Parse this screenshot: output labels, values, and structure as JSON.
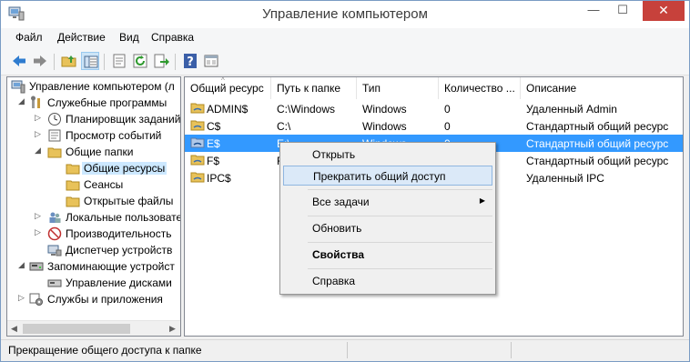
{
  "window": {
    "title": "Управление компьютером",
    "minimize": "—",
    "maximize": "☐",
    "close": "✕"
  },
  "menu": [
    "Файл",
    "Действие",
    "Вид",
    "Справка"
  ],
  "toolbar": {
    "icons": [
      "back-icon",
      "forward-icon",
      "up-folder-icon",
      "show-tree-icon",
      "properties-icon",
      "refresh-icon",
      "export-icon",
      "help-icon",
      "console-icon"
    ]
  },
  "tree": {
    "items": [
      {
        "label": "Управление компьютером (л",
        "icon": "computer-management-icon"
      },
      {
        "label": "Служебные программы",
        "icon": "tools-icon"
      },
      {
        "label": "Планировщик заданий",
        "icon": "clock-icon"
      },
      {
        "label": "Просмотр событий",
        "icon": "event-viewer-icon"
      },
      {
        "label": "Общие папки",
        "icon": "shared-folder-icon"
      },
      {
        "label": "Общие ресурсы",
        "icon": "folder-icon"
      },
      {
        "label": "Сеансы",
        "icon": "folder-icon"
      },
      {
        "label": "Открытые файлы",
        "icon": "folder-icon"
      },
      {
        "label": "Локальные пользовате",
        "icon": "users-icon"
      },
      {
        "label": "Производительность",
        "icon": "performance-icon"
      },
      {
        "label": "Диспетчер устройств",
        "icon": "device-manager-icon"
      },
      {
        "label": "Запоминающие устройст",
        "icon": "storage-icon"
      },
      {
        "label": "Управление дисками",
        "icon": "disk-icon"
      },
      {
        "label": "Службы и приложения",
        "icon": "services-icon"
      }
    ]
  },
  "list": {
    "columns": [
      "Общий ресурс",
      "Путь к папке",
      "Тип",
      "Количество ...",
      "Описание"
    ],
    "rows": [
      {
        "name": "ADMIN$",
        "path": "C:\\Windows",
        "type": "Windows",
        "count": "0",
        "desc": "Удаленный Admin"
      },
      {
        "name": "C$",
        "path": "C:\\",
        "type": "Windows",
        "count": "0",
        "desc": "Стандартный общий ресурс"
      },
      {
        "name": "E$",
        "path": "E:\\",
        "type": "Windows",
        "count": "0",
        "desc": "Стандартный общий ресурс"
      },
      {
        "name": "F$",
        "path": "F",
        "type": "",
        "count": "",
        "desc": "Стандартный общий ресурс"
      },
      {
        "name": "IPC$",
        "path": "",
        "type": "",
        "count": "",
        "desc": "Удаленный IPC"
      }
    ],
    "selected_index": 2
  },
  "context_menu": {
    "items": [
      "Открыть",
      "Прекратить общий доступ",
      "Все задачи",
      "Обновить",
      "Свойства",
      "Справка"
    ],
    "hover_index": 1
  },
  "status": {
    "text": "Прекращение общего доступа к папке"
  },
  "colors": {
    "selection": "#3399ff",
    "close_button": "#c7413b",
    "menu_hover": "#dbe9f8"
  }
}
